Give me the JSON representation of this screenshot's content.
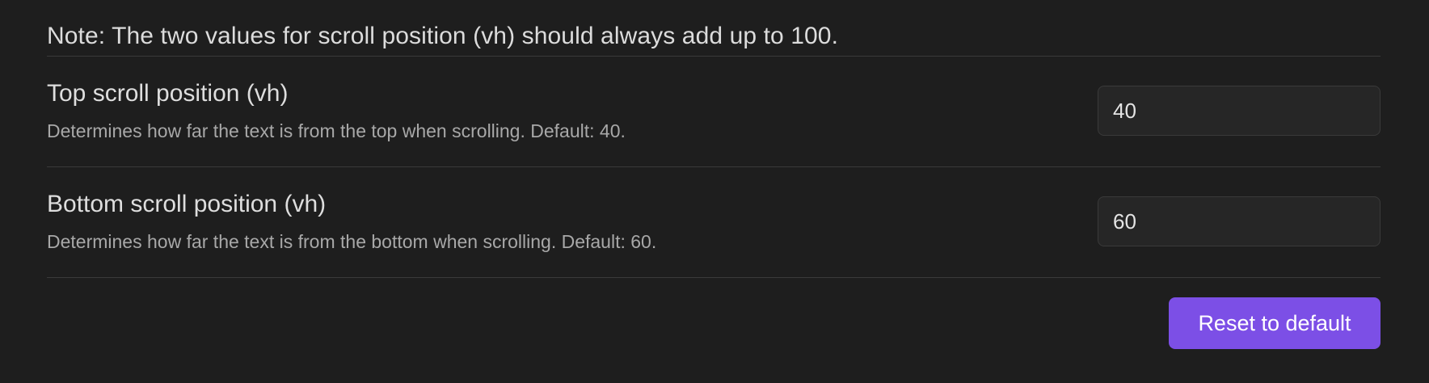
{
  "note": "Note: The two values for scroll position (vh) should always add up to 100.",
  "settings": [
    {
      "name": "Top scroll position (vh)",
      "description": "Determines how far the text is from the top when scrolling. Default: 40.",
      "value": "40"
    },
    {
      "name": "Bottom scroll position (vh)",
      "description": "Determines how far the text is from the bottom when scrolling. Default: 60.",
      "value": "60"
    }
  ],
  "reset_button_label": "Reset to default",
  "colors": {
    "background": "#1e1e1e",
    "accent": "#7c4fe6",
    "divider": "#3a3a3a"
  }
}
